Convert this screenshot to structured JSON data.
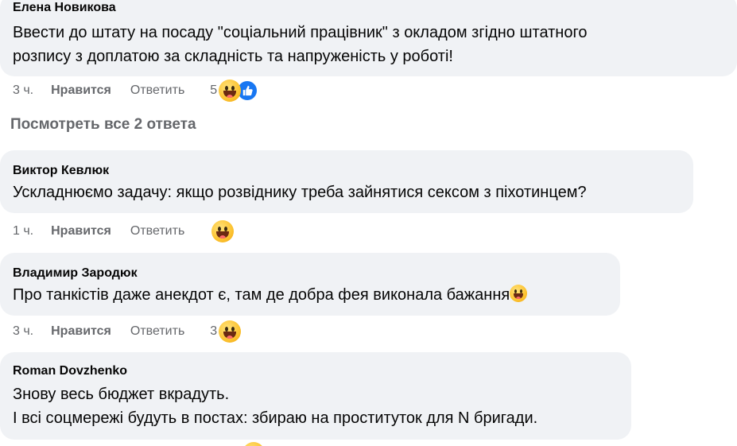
{
  "comments": [
    {
      "author": "Елена Новикова",
      "lines": [
        "Ввести до штату на посаду \"соціальний працівник\" з окладом згідно штатного",
        "розпису з доплатою за складність та напруженість у роботі!"
      ],
      "time": "3 ч.",
      "like_label": "Нравится",
      "reply_label": "Ответить",
      "reaction_count": "5"
    },
    {
      "author": "Виктор Кевлюк",
      "lines": [
        "Ускладнюємо задачу: якщо розвіднику треба зайнятися сексом з піхотинцем?"
      ],
      "time": "1 ч.",
      "like_label": "Нравится",
      "reply_label": "Ответить",
      "reaction_count": ""
    },
    {
      "author": "Владимир Зародюк",
      "lines": [
        "Про танкістів даже анекдот є, там де добра фея виконала бажання"
      ],
      "time": "3 ч.",
      "like_label": "Нравится",
      "reply_label": "Ответить",
      "reaction_count": "3"
    },
    {
      "author": "Roman Dovzhenko",
      "lines": [
        "Знову весь бюджет вкрадуть.",
        "І всі соцмережі будуть в постах: збираю на проституток для N бригади."
      ]
    }
  ],
  "view_replies_label": "Посмотреть все 2 ответа",
  "icons": {
    "reaction_haha": "laughing-emoji-icon",
    "reaction_like": "thumbs-up-icon"
  },
  "colors": {
    "bubble": "#f0f2f5",
    "secondary_text": "#65676b",
    "like_blue": "#1877f2"
  }
}
